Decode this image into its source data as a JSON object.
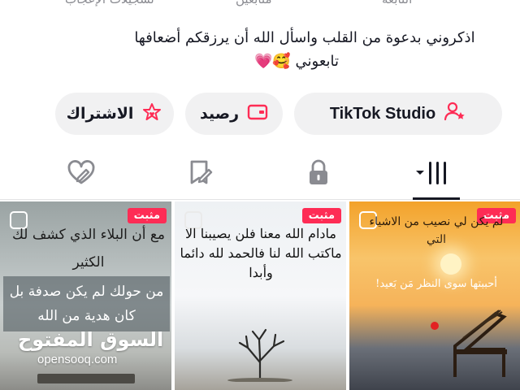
{
  "stats": {
    "likes_label": "تسجيلات الإعجاب",
    "followers_label": "متابعين",
    "following_label": "التابعة"
  },
  "bio": {
    "line1": "اذكروني بدعوة من القلب واسأل الله أن يرزقكم أضعافها",
    "line2": "تابعوني 🥰💗"
  },
  "buttons": {
    "subscribe": "الاشتراك",
    "balance": "رصيد",
    "studio": "TikTok Studio"
  },
  "tabs": {
    "icons": [
      "liked-heart-icon",
      "favorites-bookmark-icon",
      "private-lock-icon",
      "grid-posts-icon"
    ]
  },
  "videos": [
    {
      "badge": "مثبت",
      "text1": "مع أن البلاء الذي كشف لك الكثير",
      "text2": "من حولك لم يكن صدفة بل كان هدية من الله",
      "watermark_ar": "السوق المفتوح",
      "watermark_en": "opensooq.com"
    },
    {
      "badge": "مثبت",
      "text": "مادام الله معنا فلن يصيبنا الا ماكتب الله لنا فالحمد لله دائما وأبدا"
    },
    {
      "badge": "مثبت",
      "text1": "لم يكن لي نصيب من الاشياء التي",
      "text2": "أحببتها سوى النظر مَن بَعيد!"
    }
  ],
  "colors": {
    "accent": "#fe2c55",
    "button_bg": "#f1f1f2",
    "text": "#161823",
    "muted": "#8a8b91"
  }
}
